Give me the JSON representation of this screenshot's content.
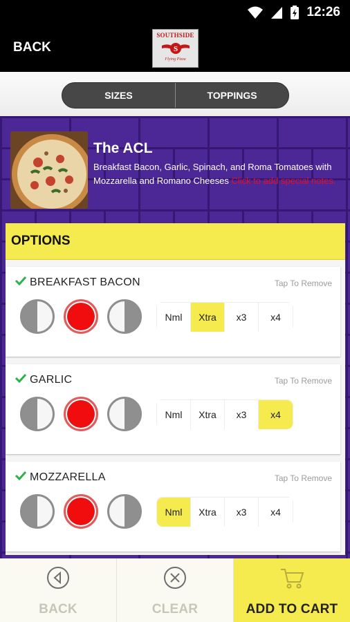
{
  "status_bar": {
    "time": "12:26"
  },
  "appbar": {
    "back_label": "BACK",
    "logo": {
      "top": "SOUTHSIDE",
      "bottom": "Flying Pizza"
    }
  },
  "tabs": [
    {
      "label": "SIZES"
    },
    {
      "label": "TOPPINGS"
    }
  ],
  "item": {
    "title": "The ACL",
    "description": "Breakfast Bacon, Garlic, Spinach, and Roma Tomatoes with Mozzarella and Romano Cheeses ",
    "special_notes_link": "Click to add special notes."
  },
  "options": {
    "header": "OPTIONS",
    "remove_label": "Tap To Remove",
    "amount_labels": [
      "Nml",
      "Xtra",
      "x3",
      "x4"
    ],
    "toppings": [
      {
        "name": "BREAKFAST BACON",
        "placement": "whole",
        "selected_amount": "Xtra"
      },
      {
        "name": "GARLIC",
        "placement": "whole",
        "selected_amount": "x4"
      },
      {
        "name": "MOZZARELLA",
        "placement": "whole",
        "selected_amount": "Nml"
      }
    ]
  },
  "bottom_bar": {
    "back_label": "BACK",
    "clear_label": "CLEAR",
    "add_to_cart_label": "ADD TO CART"
  },
  "colors": {
    "accent_yellow": "#f5ea4e",
    "brick_purple": "#4b2896",
    "topping_red": "#f10d0d",
    "check_green": "#2db14a",
    "notes_red": "#e5102a"
  }
}
